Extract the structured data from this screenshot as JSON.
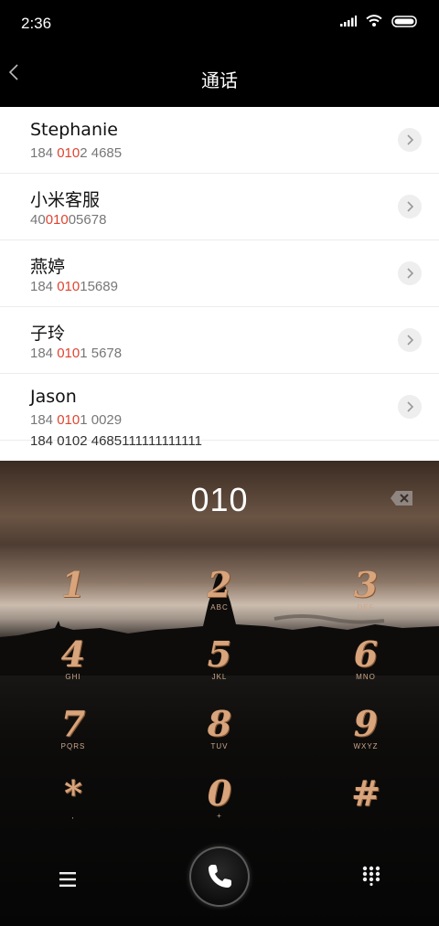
{
  "status": {
    "time": "2:36"
  },
  "header": {
    "title": "通话"
  },
  "contacts": [
    {
      "name": "Stephanie",
      "num_pre": "184 ",
      "num_hl": "010",
      "num_post": "2 4685"
    },
    {
      "name": "小米客服",
      "num_pre": "40",
      "num_hl": "010",
      "num_post": "05678"
    },
    {
      "name": "燕婷",
      "num_pre": "184 ",
      "num_hl": "010",
      "num_post": "15689"
    },
    {
      "name": "子玲",
      "num_pre": "184 ",
      "num_hl": "010",
      "num_post": "1 5678"
    },
    {
      "name": "Jason",
      "num_pre": "184 ",
      "num_hl": "010",
      "num_post": "1 0029"
    },
    {
      "name": "184 0102 4685111111111111",
      "num_pre": "",
      "num_hl": "",
      "num_post": ""
    }
  ],
  "dialer": {
    "input": "010",
    "keys": [
      {
        "digit": "1",
        "letters": ""
      },
      {
        "digit": "2",
        "letters": "ABC"
      },
      {
        "digit": "3",
        "letters": "DEF"
      },
      {
        "digit": "4",
        "letters": "GHI"
      },
      {
        "digit": "5",
        "letters": "JKL"
      },
      {
        "digit": "6",
        "letters": "MNO"
      },
      {
        "digit": "7",
        "letters": "PQRS"
      },
      {
        "digit": "8",
        "letters": "TUV"
      },
      {
        "digit": "9",
        "letters": "WXYZ"
      },
      {
        "digit": "*",
        "letters": ","
      },
      {
        "digit": "0",
        "letters": "+"
      },
      {
        "digit": "#",
        "letters": ""
      }
    ]
  },
  "icons": {
    "back": "chevron-left-icon",
    "backspace": "backspace-icon",
    "menu": "menu-icon",
    "call": "phone-icon",
    "keypad": "keypad-icon"
  },
  "colors": {
    "highlight": "#e0432f",
    "digit": "#d7a47c"
  }
}
